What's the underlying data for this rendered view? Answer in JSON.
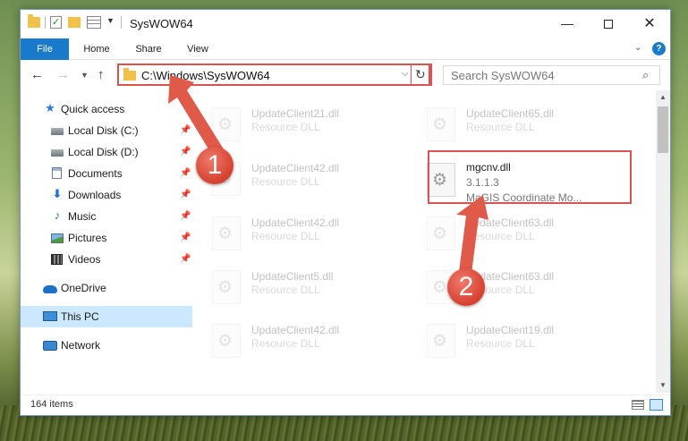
{
  "window": {
    "title": "SysWOW64",
    "controls": {
      "minimize": "—",
      "close": "✕"
    }
  },
  "ribbon": {
    "tabs": [
      "File",
      "Home",
      "Share",
      "View"
    ]
  },
  "address_bar": {
    "path": "C:\\Windows\\SysWOW64"
  },
  "search": {
    "placeholder": "Search SysWOW64"
  },
  "sidebar": {
    "items": [
      {
        "label": "Quick access",
        "icon": "star-icon",
        "pinned": false
      },
      {
        "label": "Local Disk (C:)",
        "icon": "drive-icon",
        "pinned": true
      },
      {
        "label": "Local Disk (D:)",
        "icon": "drive-icon",
        "pinned": true
      },
      {
        "label": "Documents",
        "icon": "documents-icon",
        "pinned": true
      },
      {
        "label": "Downloads",
        "icon": "download-icon",
        "pinned": true
      },
      {
        "label": "Music",
        "icon": "music-icon",
        "pinned": true
      },
      {
        "label": "Pictures",
        "icon": "pictures-icon",
        "pinned": true
      },
      {
        "label": "Videos",
        "icon": "video-icon",
        "pinned": true
      },
      {
        "label": "OneDrive",
        "icon": "cloud-icon",
        "pinned": false
      },
      {
        "label": "This PC",
        "icon": "computer-icon",
        "pinned": false,
        "selected": true
      },
      {
        "label": "Network",
        "icon": "network-icon",
        "pinned": false
      }
    ]
  },
  "files": {
    "left_column": [
      {
        "name": "UpdateClient21.dll",
        "type": "Resource DLL"
      },
      {
        "name": "UpdateClient42.dll",
        "type": "Resource DLL"
      },
      {
        "name": "UpdateClient42.dll",
        "type": "Resource DLL"
      },
      {
        "name": "UpdateClient5.dll",
        "type": "Resource DLL"
      },
      {
        "name": "UpdateClient42.dll",
        "type": "Resource DLL"
      }
    ],
    "right_column": [
      {
        "name": "UpdateClient65.dll",
        "type": "Resource DLL"
      },
      {
        "name": "UpdateClient63.dll",
        "type": "Resource DLL"
      },
      {
        "name": "UpdateClient63.dll",
        "type": "Resource DLL"
      },
      {
        "name": "UpdateClient19.dll",
        "type": "Resource DLL"
      }
    ],
    "highlighted": {
      "name": "mgcnv.dll",
      "version": "3.1.1.3",
      "description": "MaGIS Coordinate Mo..."
    }
  },
  "status": {
    "item_count": "164 items"
  },
  "annotations": {
    "step1": "1",
    "step2": "2",
    "color": "#d9534f"
  }
}
